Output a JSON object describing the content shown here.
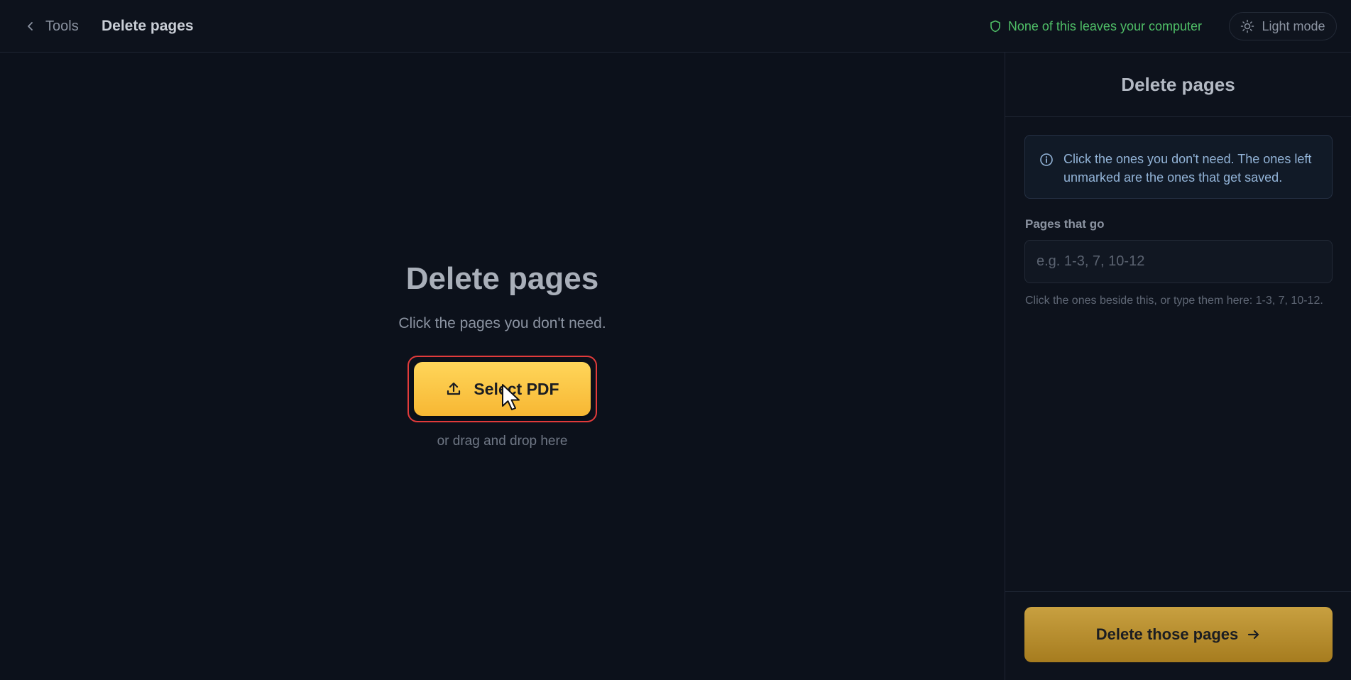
{
  "header": {
    "back_label": "Tools",
    "page_title": "Delete pages",
    "privacy_note": "None of this leaves your computer",
    "mode_toggle_label": "Light mode"
  },
  "main": {
    "title": "Delete pages",
    "subtitle": "Click the pages you don't need.",
    "select_button_label": "Select PDF",
    "drop_hint": "or drag and drop here"
  },
  "sidebar": {
    "title": "Delete pages",
    "info_text": "Click the ones you don't need. The ones left unmarked are the ones that get saved.",
    "field_label": "Pages that go",
    "field_value": "",
    "field_placeholder": "e.g. 1-3, 7, 10-12",
    "field_hint": "Click the ones beside this, or type them here: 1-3, 7, 10-12.",
    "submit_label": "Delete those pages"
  },
  "icons": {
    "back": "chevron-left-icon",
    "privacy": "shield-icon",
    "mode": "sun-icon",
    "upload": "upload-icon",
    "info": "info-icon",
    "submit": "arrow-right-icon",
    "cursor": "mouse-pointer-icon"
  },
  "colors": {
    "accent": "#f7b733",
    "privacy_green": "#4fbf67",
    "highlight_border": "#e23b3b",
    "background": "#0c111b"
  }
}
